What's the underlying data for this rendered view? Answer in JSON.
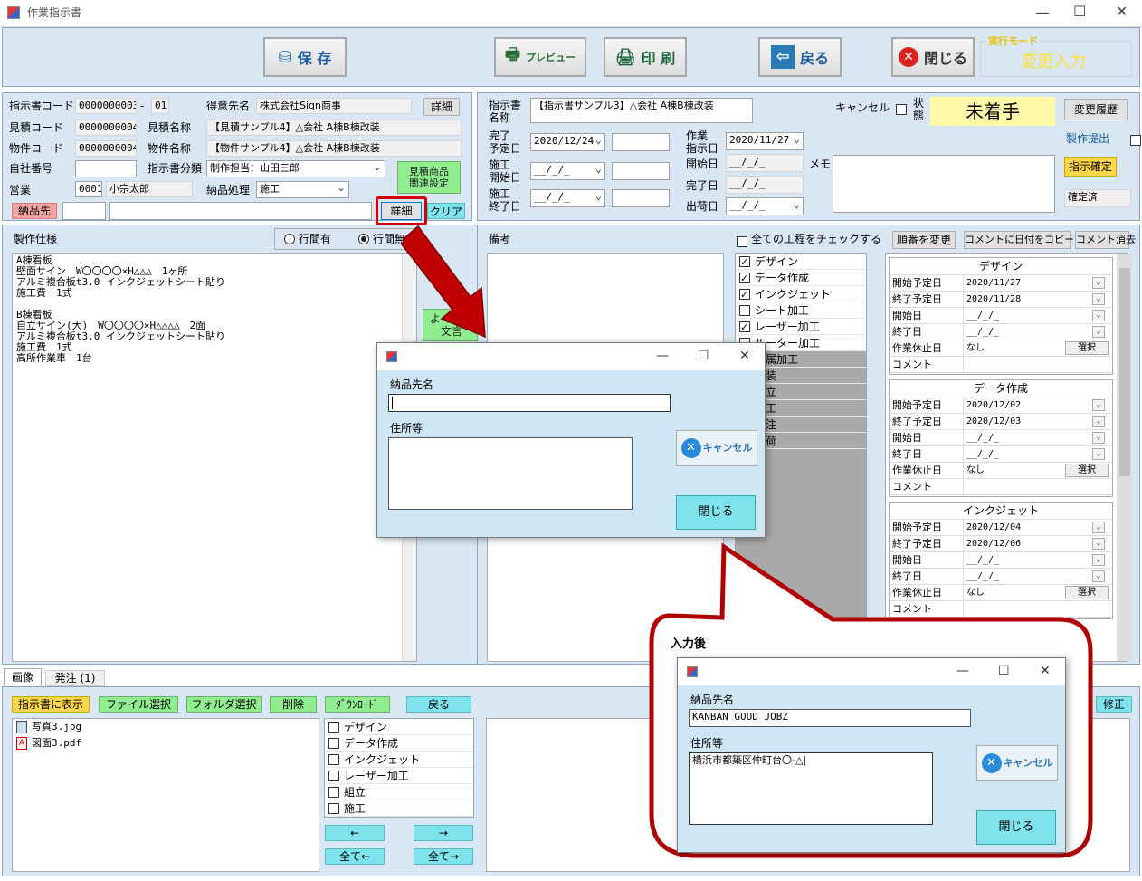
{
  "window": {
    "title": "作業指示書"
  },
  "toolbar": {
    "save": "保 存",
    "preview": "プレビュー",
    "print": "印 刷",
    "back": "戻る",
    "close": "閉じる",
    "mode_label": "実行モード",
    "mode_value": "変更入力"
  },
  "header_left": {
    "order_code_label": "指示書コード",
    "order_code": "0000000003",
    "order_code_sep": "-",
    "order_code_sub": "01",
    "client_label": "得意先名",
    "client": "株式会社Sign商事",
    "client_detail": "詳細",
    "estimate_code_label": "見積コード",
    "estimate_code": "0000000004",
    "estimate_name_label": "見積名称",
    "estimate_name": "【見積サンプル4】△会社 A棟B棟改装",
    "property_code_label": "物件コード",
    "property_code": "0000000004",
    "property_name_label": "物件名称",
    "property_name": "【物件サンプル4】△会社 A棟B棟改装",
    "internal_no_label": "自社番号",
    "internal_no": "",
    "category_label": "指示書分類",
    "category": "制作担当：山田三郎",
    "related_button": "見積商品\n関連設定",
    "sales_label": "営業",
    "sales_code": "0001",
    "sales_name": "小宗太郎",
    "delivery_proc_label": "納品処理",
    "delivery_proc": "施工",
    "delivery_dest_label": "納品先",
    "delivery_detail": "詳細",
    "delivery_clear": "クリア"
  },
  "header_right": {
    "order_name_label": "指示書\n名称",
    "order_name": "【指示書サンプル3】△会社 A棟B棟改装",
    "cancel_label": "キャンセル",
    "status_label": "状\n態",
    "status": "未着手",
    "history_button": "変更履歴",
    "due_label": "完了\n予定日",
    "due": "2020/12/24",
    "instruct_label": "作業\n指示日",
    "instruct": "2020/11/27",
    "start_plan_label": "施工\n開始日",
    "start_plan": "__/_/_",
    "start_label": "開始日",
    "start": "__/_/_",
    "memo_label": "メモ",
    "production_submit": "製作提出",
    "confirm_button": "指示確定",
    "end_plan_label": "施工\n終了日",
    "end_plan": "__/_/_",
    "complete_label": "完了日",
    "complete": "__/_/_",
    "ship_label": "出荷日",
    "ship": "__/_/_",
    "confirmed": "確定済"
  },
  "spec": {
    "title": "製作仕様",
    "radio_with": "行間有",
    "radio_without": "行間無",
    "text": "A棟看板\n壁面サイン　W〇〇〇〇×H△△△　1ヶ所\nアルミ複合板t3.0 インクジェットシート貼り\n施工費　1式\n\nB棟看板\n自立サイン(大)　W〇〇〇〇×H△△△△　2面\nアルミ複合板t3.0 インクジェットシート貼り\n施工費　1式\n高所作業車　1台",
    "phrase_button": "よく使う\n文言"
  },
  "notes": {
    "title": "備考",
    "check_all": "全ての工程をチェックする",
    "reorder": "順番を変更",
    "copy_date": "コメントに日付をコピー",
    "clear_comment": "コメント消去"
  },
  "processes": [
    {
      "name": "デザイン",
      "checked": true
    },
    {
      "name": "データ作成",
      "checked": true
    },
    {
      "name": "インクジェット",
      "checked": true
    },
    {
      "name": "シート加工",
      "checked": false
    },
    {
      "name": "レーザー加工",
      "checked": true
    },
    {
      "name": "ルーター加工",
      "checked": false
    },
    {
      "name": "金属加工",
      "checked": false
    },
    {
      "name": "塗装",
      "checked": false
    },
    {
      "name": "組立",
      "checked": false
    },
    {
      "name": "施工",
      "checked": false
    },
    {
      "name": "外注",
      "checked": false
    },
    {
      "name": "出荷",
      "checked": false
    }
  ],
  "process_panels": [
    {
      "title": "デザイン",
      "rows": [
        {
          "label": "開始予定日",
          "value": "2020/11/27",
          "dd": true
        },
        {
          "label": "終了予定日",
          "value": "2020/11/28",
          "dd": true
        },
        {
          "label": "開始日",
          "value": "__/_/_",
          "dd": true
        },
        {
          "label": "終了日",
          "value": "__/_/_",
          "dd": true
        },
        {
          "label": "作業休止日",
          "value": "なし",
          "btn": "選択"
        },
        {
          "label": "コメント",
          "value": ""
        }
      ]
    },
    {
      "title": "データ作成",
      "rows": [
        {
          "label": "開始予定日",
          "value": "2020/12/02",
          "dd": true
        },
        {
          "label": "終了予定日",
          "value": "2020/12/03",
          "dd": true
        },
        {
          "label": "開始日",
          "value": "__/_/_",
          "dd": true
        },
        {
          "label": "終了日",
          "value": "__/_/_",
          "dd": true
        },
        {
          "label": "作業休止日",
          "value": "なし",
          "btn": "選択"
        },
        {
          "label": "コメント",
          "value": ""
        }
      ]
    },
    {
      "title": "インクジェット",
      "rows": [
        {
          "label": "開始予定日",
          "value": "2020/12/04",
          "dd": true
        },
        {
          "label": "終了予定日",
          "value": "2020/12/06",
          "dd": true
        },
        {
          "label": "開始日",
          "value": "__/_/_",
          "dd": true
        },
        {
          "label": "終了日",
          "value": "__/_/_",
          "dd": true
        },
        {
          "label": "作業休止日",
          "value": "なし",
          "btn": "選択"
        },
        {
          "label": "コメント",
          "value": ""
        }
      ]
    }
  ],
  "bottom": {
    "tab_image": "画像",
    "tab_order": "発注 (1)",
    "show_in_order": "指示書に表示",
    "select_file": "ファイル選択",
    "select_folder": "フォルダ選択",
    "delete": "削除",
    "download": "ﾀﾞｳﾝﾛｰﾄﾞ",
    "back": "戻る",
    "files": [
      "写真3.jpg",
      "図面3.pdf"
    ],
    "proc_list": [
      "デザイン",
      "データ作成",
      "インクジェット",
      "レーザー加工",
      "組立",
      "施工"
    ],
    "move_left": "←",
    "move_right": "→",
    "all_left": "全て←",
    "all_right": "全て→",
    "modify": "修正"
  },
  "dialog1": {
    "name_label": "納品先名",
    "name_value": "",
    "addr_label": "住所等",
    "addr_value": "",
    "cancel": "キャンセル",
    "close": "閉じる"
  },
  "callout": {
    "title": "入力後",
    "name_label": "納品先名",
    "name_value": "KANBAN GOOD JOBZ",
    "addr_label": "住所等",
    "addr_value": "横浜市都築区仲町台〇-△|",
    "cancel": "キャンセル",
    "close": "閉じる"
  },
  "colors": {
    "accent": "#cc0000",
    "panel": "#d9e6f3",
    "status_bg": "#fff9a8"
  }
}
